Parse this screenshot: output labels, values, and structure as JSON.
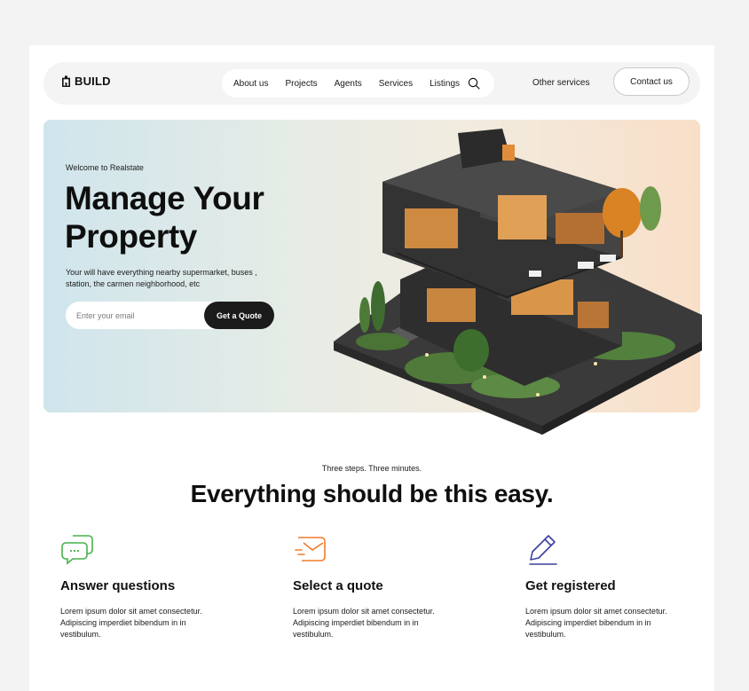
{
  "brand": {
    "name": "BUILD"
  },
  "nav": {
    "links": [
      "About us",
      "Projects",
      "Agents",
      "Services",
      "Listings"
    ],
    "other_services": "Other services",
    "contact": "Contact us"
  },
  "hero": {
    "eyebrow": "Welcome to Realstate",
    "headline": "Manage Your Property",
    "subtext": "Your will have everything nearby supermarket, buses , station, the carmen neighborhood, etc",
    "email_placeholder": "Enter your email",
    "cta": "Get a Quote"
  },
  "steps": {
    "eyebrow": "Three steps. Three minutes.",
    "title": "Everything should be this easy.",
    "items": [
      {
        "icon": "chat-bubbles-icon",
        "title": "Answer questions",
        "text": "Lorem ipsum dolor sit amet consectetur. Adipiscing imperdiet bibendum in in vestibulum.",
        "color": "#47b04a"
      },
      {
        "icon": "mail-quote-icon",
        "title": "Select a quote",
        "text": "Lorem ipsum dolor sit amet consectetur. Adipiscing imperdiet bibendum in in vestibulum.",
        "color": "#f07b2a"
      },
      {
        "icon": "pen-icon",
        "title": "Get registered",
        "text": "Lorem ipsum dolor sit amet consectetur. Adipiscing imperdiet bibendum in in vestibulum.",
        "color": "#3b3fa0"
      }
    ]
  },
  "colors": {
    "dark": "#1b1b1b",
    "nav_bg": "#f4f4f4"
  }
}
